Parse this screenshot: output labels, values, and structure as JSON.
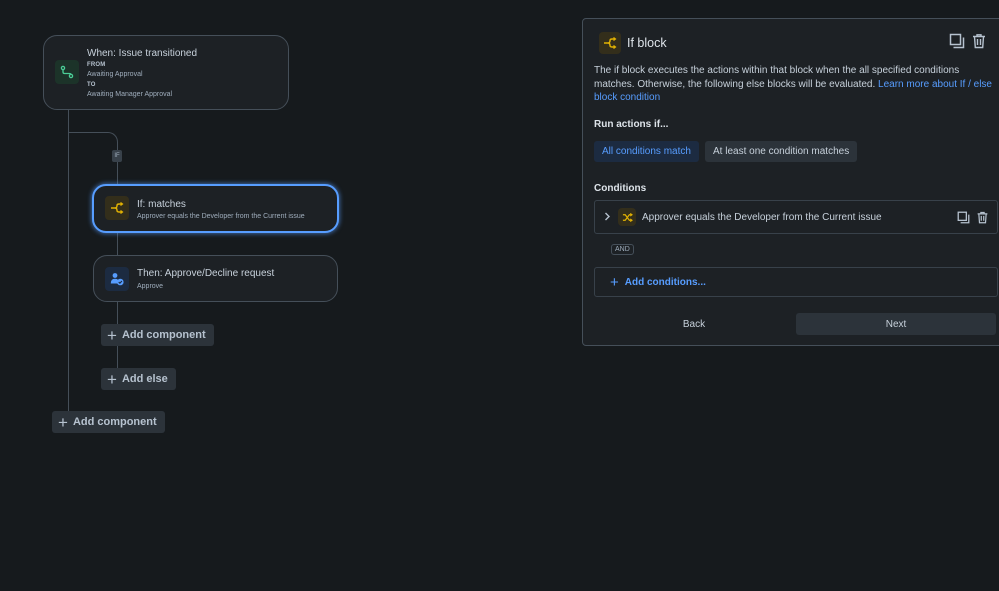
{
  "trigger": {
    "title": "When: Issue transitioned",
    "from_label": "FROM",
    "from_value": "Awaiting Approval",
    "to_label": "TO",
    "to_value": "Awaiting Manager Approval"
  },
  "if_badge": "IF",
  "if_card": {
    "title": "If: matches",
    "subtitle": "Approver equals the Developer from the Current issue"
  },
  "then_card": {
    "title": "Then: Approve/Decline request",
    "subtitle": "Approve"
  },
  "add_component_inner": "Add component",
  "add_else": "Add else",
  "add_component_outer": "Add component",
  "panel": {
    "title": "If block",
    "description": "The if block executes the actions within that block when the all specified conditions matches. Otherwise, the following else blocks will be evaluated.",
    "link_text": "Learn more about If / else block condition",
    "run_label": "Run actions if...",
    "option_all": "All conditions match",
    "option_any": "At least one condition matches",
    "conditions_label": "Conditions",
    "condition_text": "Approver equals the Developer from the Current issue",
    "and_label": "AND",
    "add_conditions": "Add conditions...",
    "back": "Back",
    "next": "Next"
  },
  "colors": {
    "background": "#161a1d",
    "accent": "#579dff",
    "trigger_icon": "#4bce97",
    "condition_icon": "#e2b203"
  }
}
